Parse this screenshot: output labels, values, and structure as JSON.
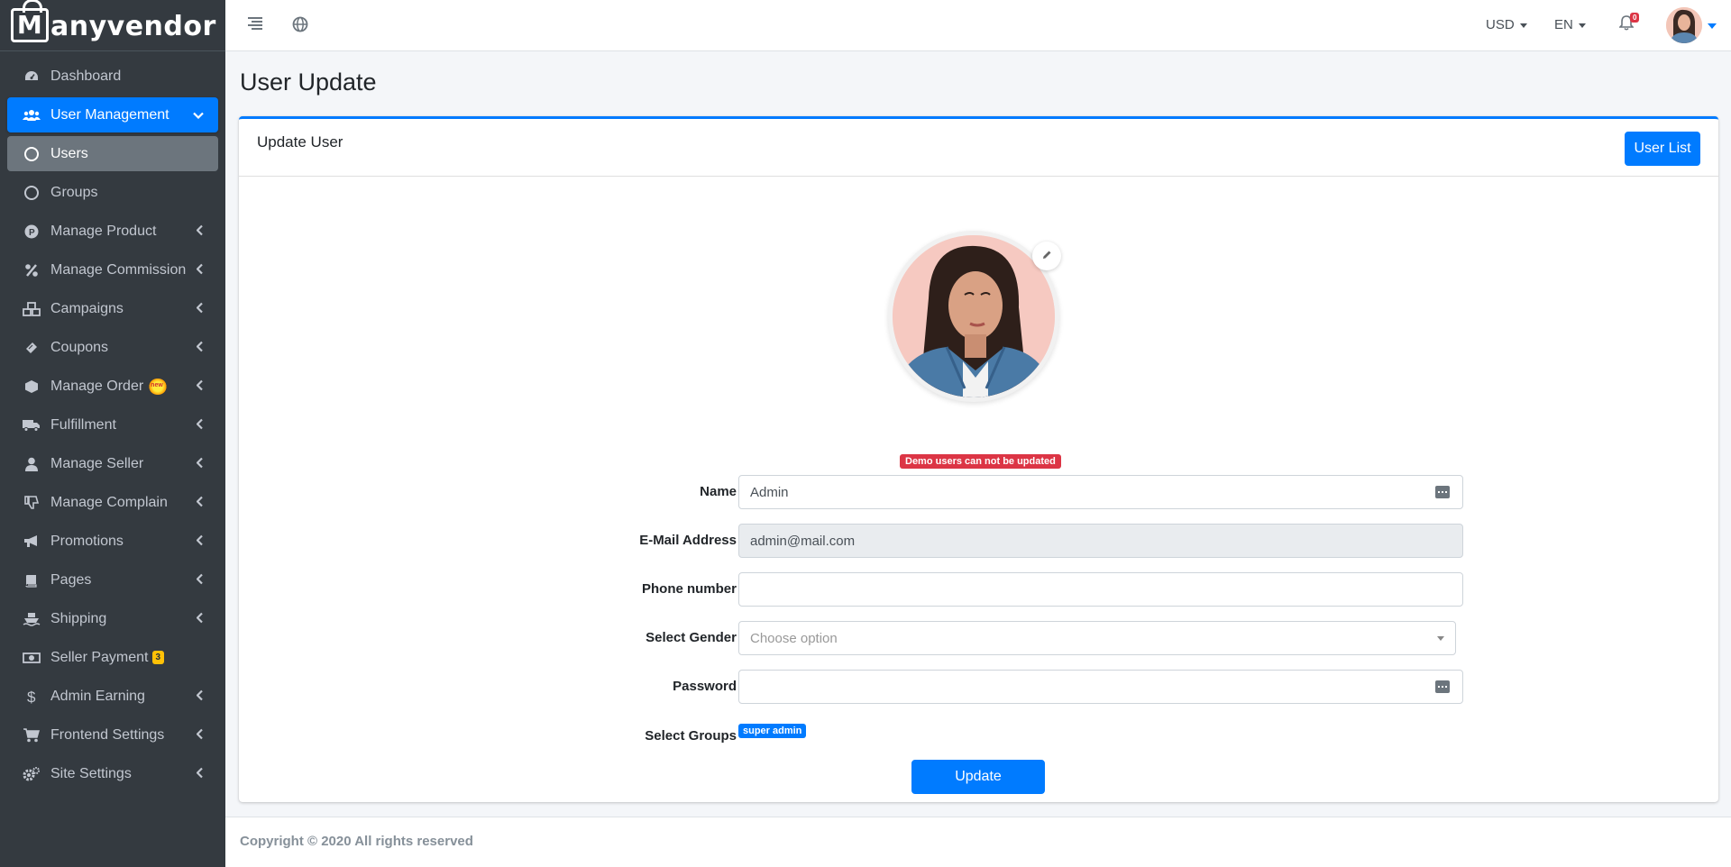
{
  "brand": {
    "name": "anyvendor",
    "initial": "M"
  },
  "sidebar": {
    "items": [
      {
        "label": "Dashboard",
        "icon": "dashboard-icon",
        "chevron": ""
      },
      {
        "label": "User Management",
        "icon": "users-icon",
        "chevron": "⌄"
      },
      {
        "label": "Users",
        "icon": "circle-icon",
        "chevron": ""
      },
      {
        "label": "Groups",
        "icon": "circle-icon",
        "chevron": ""
      },
      {
        "label": "Manage Product",
        "icon": "product-icon",
        "chevron": "‹"
      },
      {
        "label": "Manage Commission",
        "icon": "percent-icon",
        "chevron": "‹"
      },
      {
        "label": "Campaigns",
        "icon": "cubes-icon",
        "chevron": "‹"
      },
      {
        "label": "Coupons",
        "icon": "ticket-icon",
        "chevron": "‹"
      },
      {
        "label": "Manage Order",
        "icon": "box-icon",
        "chevron": "‹"
      },
      {
        "label": "Fulfillment",
        "icon": "truck-icon",
        "chevron": "‹"
      },
      {
        "label": "Manage Seller",
        "icon": "user-icon",
        "chevron": "‹"
      },
      {
        "label": "Manage Complain",
        "icon": "thumbs-down-icon",
        "chevron": "‹"
      },
      {
        "label": "Promotions",
        "icon": "bullhorn-icon",
        "chevron": "‹"
      },
      {
        "label": "Pages",
        "icon": "book-icon",
        "chevron": "‹"
      },
      {
        "label": "Shipping",
        "icon": "ship-icon",
        "chevron": "‹"
      },
      {
        "label": "Seller Payment",
        "icon": "money-icon",
        "chevron": ""
      },
      {
        "label": "Admin Earning",
        "icon": "dollar-icon",
        "chevron": "‹"
      },
      {
        "label": "Frontend Settings",
        "icon": "cart-icon",
        "chevron": "‹"
      },
      {
        "label": "Site Settings",
        "icon": "cogs-icon",
        "chevron": "‹"
      }
    ],
    "seller_payment_count": "3"
  },
  "header": {
    "currency": "USD",
    "language": "EN",
    "notification_count": "0"
  },
  "page": {
    "title": "User Update"
  },
  "card": {
    "title": "Update User",
    "user_list_button": "User List"
  },
  "form": {
    "demo_notice": "Demo users can not be updated",
    "name_label": "Name",
    "name_value": "Admin",
    "email_label": "E-Mail Address",
    "email_value": "admin@mail.com",
    "phone_label": "Phone number",
    "phone_value": "",
    "gender_label": "Select Gender",
    "gender_placeholder": "Choose option",
    "password_label": "Password",
    "password_value": "",
    "groups_label": "Select Groups",
    "group_tag": "super admin",
    "update_button": "Update"
  },
  "footer": {
    "text": "Copyright © 2020 All rights reserved"
  },
  "colors": {
    "primary": "#007bff",
    "sidebar_bg": "#343a40",
    "danger": "#dc3545",
    "warning": "#ffc107"
  }
}
